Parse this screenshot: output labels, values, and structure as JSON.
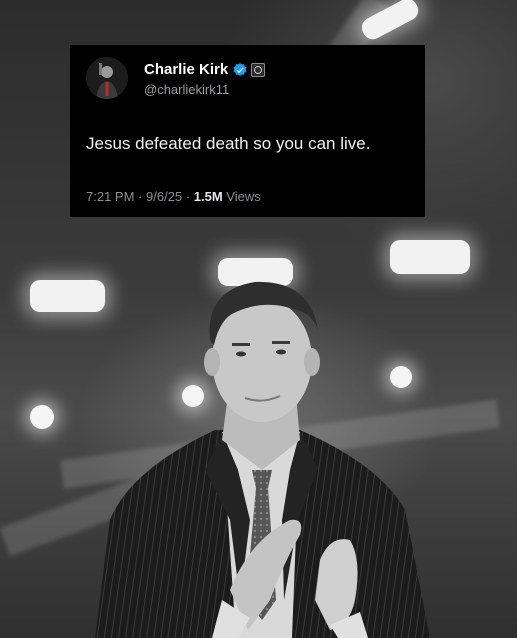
{
  "tweet": {
    "author_name": "Charlie Kirk",
    "handle": "@charliekirk11",
    "text": "Jesus defeated death so you can live.",
    "time": "7:21 PM",
    "separator": "·",
    "date": "9/6/25",
    "views_count": "1.5M",
    "views_label": "Views"
  },
  "icons": {
    "verified": "verified-badge-icon",
    "affiliation": "affiliation-badge-icon"
  },
  "colors": {
    "tweet_background": "#000000",
    "verified_blue": "#1d9bf0"
  }
}
